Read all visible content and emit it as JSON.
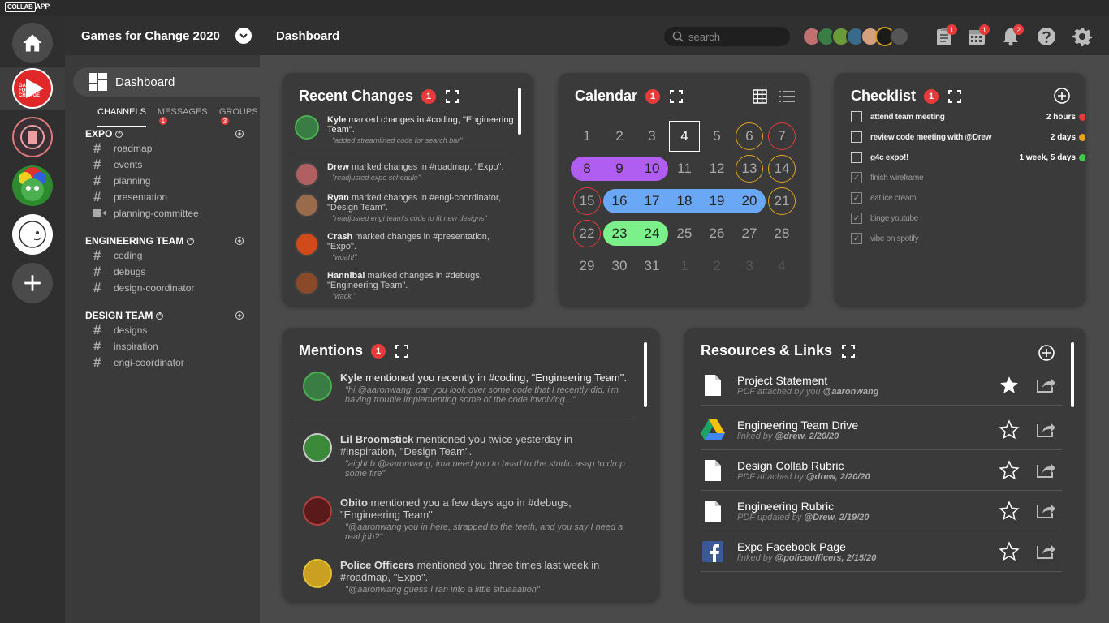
{
  "app": {
    "logo_box": "COLLAB",
    "logo_text": "APP"
  },
  "rail": {
    "items": [
      "home",
      "games-for-change",
      "project-2",
      "project-3",
      "project-4",
      "add"
    ]
  },
  "sidebar": {
    "project_title": "Games for Change 2020",
    "dashboard_label": "Dashboard",
    "tabs": [
      {
        "label": "CHANNELS",
        "badge": ""
      },
      {
        "label": "MESSAGES",
        "badge": "1"
      },
      {
        "label": "GROUPS",
        "badge": "3"
      }
    ],
    "groups": [
      {
        "title": "EXPO",
        "channels": [
          "roadmap",
          "events",
          "planning",
          "presentation",
          "planning-committee"
        ]
      },
      {
        "title": "ENGINEERING TEAM",
        "channels": [
          "coding",
          "debugs",
          "design-coordinator"
        ]
      },
      {
        "title": "DESIGN TEAM",
        "channels": [
          "designs",
          "inspiration",
          "engi-coordinator"
        ]
      }
    ]
  },
  "topbar": {
    "title": "Dashboard",
    "search_placeholder": "search",
    "clipboard_badge": "1",
    "calendar_badge": "1",
    "bell_badge": "2"
  },
  "recent_changes": {
    "title": "Recent Changes",
    "badge": "1",
    "items": [
      {
        "name": "Kyle",
        "text": " marked changes in #coding, \"Engineering Team\".",
        "quote": "\"added streamlined code for search bar\"",
        "color": "#3a7d44"
      },
      {
        "name": "Drew",
        "text": " marked changes in #roadmap, \"Expo\".",
        "quote": "\"readjusted expo schedule\"",
        "color": "#b06060"
      },
      {
        "name": "Ryan",
        "text": " marked changes in #engi-coordinator, \"Design Team\".",
        "quote": "\"readjusted engi team's code to fit new designs\"",
        "color": "#9a6b4a"
      },
      {
        "name": "Crash",
        "text": " marked changes in #presentation, \"Expo\".",
        "quote": "\"woah!\"",
        "color": "#d04a1a"
      },
      {
        "name": "Hannibal",
        "text": " marked changes in #debugs, \"Engineering Team\".",
        "quote": "\"wack.\"",
        "color": "#8a4a2a"
      }
    ]
  },
  "calendar": {
    "title": "Calendar",
    "badge": "1",
    "weeks": [
      [
        "1",
        "2",
        "3",
        "4",
        "5",
        "6",
        "7"
      ],
      [
        "8",
        "9",
        "10",
        "11",
        "12",
        "13",
        "14"
      ],
      [
        "15",
        "16",
        "17",
        "18",
        "19",
        "20",
        "21"
      ],
      [
        "22",
        "23",
        "24",
        "25",
        "26",
        "27",
        "28"
      ],
      [
        "29",
        "30",
        "31",
        "1",
        "2",
        "3",
        "4"
      ]
    ]
  },
  "checklist": {
    "title": "Checklist",
    "badge": "1",
    "items": [
      {
        "text": "attend team meeting",
        "due": "2 hours",
        "dot": "#e63b3b",
        "done": false
      },
      {
        "text": "review code meeting with @Drew",
        "due": "2 days",
        "dot": "#e6a11f",
        "done": false
      },
      {
        "text": "g4c expo!!",
        "due": "1 week, 5 days",
        "dot": "#3ec94a",
        "done": false
      },
      {
        "text": "finish wireframe",
        "due": "",
        "dot": "",
        "done": true
      },
      {
        "text": "eat ice cream",
        "due": "",
        "dot": "",
        "done": true
      },
      {
        "text": "binge youtube",
        "due": "",
        "dot": "",
        "done": true
      },
      {
        "text": "vibe on spotify",
        "due": "",
        "dot": "",
        "done": true
      }
    ]
  },
  "mentions": {
    "title": "Mentions",
    "badge": "1",
    "items": [
      {
        "name": "Kyle",
        "text": " mentioned you recently in #coding, \"Engineering Team\".",
        "quote": "\"hi @aaronwang, can you look over some code that I recently did, i'm having trouble implementing some of the code involving...\"",
        "color": "#3a7d44"
      },
      {
        "name": "Lil Broomstick",
        "text": " mentioned you twice yesterday in #inspiration, \"Design Team\".",
        "quote": "\"aight b @aaronwang, ima need you to head to the studio asap to drop some fire\"",
        "color": "#3a8a3a"
      },
      {
        "name": "Obito",
        "text": " mentioned you a few days ago in #debugs, \"Engineering Team\".",
        "quote": "\"@aaronwang  you in here, strapped to the teeth, and you say I need a real job?\"",
        "color": "#6a2020"
      },
      {
        "name": "Police Officers",
        "text": " mentioned you three times last week in #roadmap, \"Expo\".",
        "quote": "\"@aaronwang  guess I ran into a little situaaation\"",
        "color": "#c9a020"
      }
    ]
  },
  "resources": {
    "title": "Resources & Links",
    "items": [
      {
        "name": "Project Statement",
        "meta_prefix": "PDF attached by you ",
        "meta_user": "@aaronwang",
        "icon": "pdf-icon",
        "starred": true
      },
      {
        "name": "Engineering Team Drive",
        "meta_prefix": "linked by ",
        "meta_user": "@drew, 2/20/20",
        "icon": "drive-icon",
        "starred": false
      },
      {
        "name": "Design Collab Rubric",
        "meta_prefix": "PDF attached by ",
        "meta_user": "@drew, 2/20/20",
        "icon": "pdf-icon",
        "starred": false
      },
      {
        "name": "Engineering Rubric",
        "meta_prefix": "PDF updated by ",
        "meta_user": "@Drew, 2/19/20",
        "icon": "pdf-icon",
        "starred": false
      },
      {
        "name": "Expo Facebook Page",
        "meta_prefix": "linked by ",
        "meta_user": "@policeofficers, 2/15/20",
        "icon": "facebook-icon",
        "starred": false
      }
    ]
  }
}
